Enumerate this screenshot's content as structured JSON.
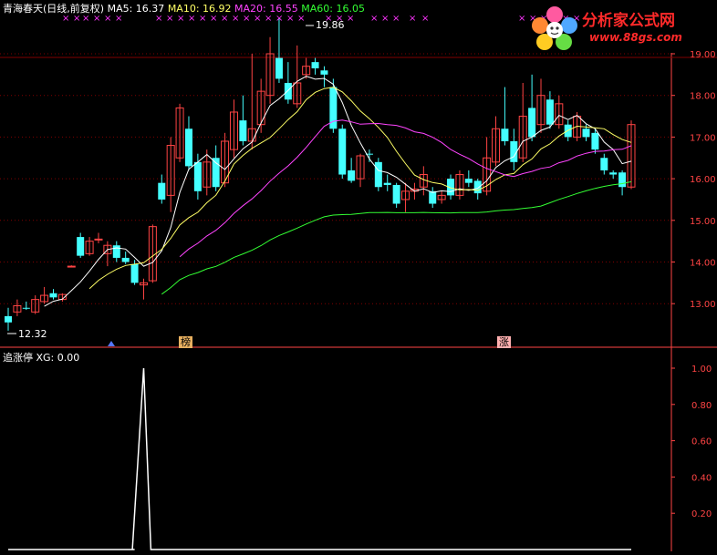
{
  "header": {
    "title": "青海春天(日线,前复权)",
    "ma": [
      {
        "label": "MA5: 16.37",
        "color": "#ffffff"
      },
      {
        "label": "MA10: 16.92",
        "color": "#ffff66"
      },
      {
        "label": "MA20: 16.55",
        "color": "#ff44ff"
      },
      {
        "label": "MA60: 16.05",
        "color": "#33ff33"
      }
    ]
  },
  "logo": {
    "title": "分析家公式网",
    "url": "www.88gs.com"
  },
  "price_annotations": {
    "high": "19.86",
    "low": "12.32"
  },
  "event_tags": [
    {
      "label": "榜",
      "color": "#e8b060"
    },
    {
      "label": "涨",
      "color": "#ffb0b0"
    }
  ],
  "indicator": {
    "label": "追涨停  XG: 0.00"
  },
  "colors": {
    "up": "#ff4444",
    "down": "#44ffff",
    "grid": "#800000",
    "axis": "#ff4444"
  },
  "chart_data": [
    {
      "type": "candlestick",
      "y_ticks": [
        "19.00",
        "18.00",
        "17.00",
        "16.00",
        "15.00",
        "14.00",
        "13.00"
      ],
      "ylim": [
        12.3,
        19.9
      ],
      "candles": [
        [
          12.7,
          12.55,
          12.9,
          12.35
        ],
        [
          12.8,
          12.95,
          13.1,
          12.7
        ],
        [
          12.9,
          12.88,
          13.05,
          12.85
        ],
        [
          12.8,
          13.1,
          13.2,
          12.75
        ],
        [
          13.05,
          13.2,
          13.4,
          13.0
        ],
        [
          13.25,
          13.15,
          13.35,
          13.1
        ],
        [
          13.1,
          13.22,
          13.25,
          13.05
        ],
        [
          13.9,
          13.9,
          13.92,
          13.88
        ],
        [
          14.6,
          14.15,
          14.7,
          14.1
        ],
        [
          14.2,
          14.5,
          14.6,
          14.15
        ],
        [
          14.55,
          14.55,
          14.7,
          14.45
        ],
        [
          14.2,
          14.4,
          14.5,
          13.9
        ],
        [
          14.4,
          14.1,
          14.5,
          14.0
        ],
        [
          14.1,
          14.0,
          14.25,
          13.95
        ],
        [
          13.95,
          13.5,
          14.05,
          13.45
        ],
        [
          13.45,
          13.5,
          13.6,
          13.1
        ],
        [
          13.55,
          14.85,
          14.9,
          13.5
        ],
        [
          15.9,
          15.5,
          16.1,
          15.4
        ],
        [
          15.6,
          16.8,
          17.0,
          15.2
        ],
        [
          16.5,
          17.7,
          17.8,
          16.4
        ],
        [
          17.2,
          16.3,
          17.5,
          16.2
        ],
        [
          16.4,
          15.7,
          16.6,
          15.5
        ],
        [
          15.8,
          16.4,
          16.7,
          15.6
        ],
        [
          16.5,
          15.8,
          16.8,
          15.7
        ],
        [
          15.9,
          16.9,
          17.1,
          15.8
        ],
        [
          16.7,
          17.6,
          17.9,
          16.5
        ],
        [
          17.4,
          16.9,
          18.0,
          16.8
        ],
        [
          16.9,
          17.2,
          19.0,
          16.7
        ],
        [
          17.3,
          18.1,
          18.4,
          17.1
        ],
        [
          18.0,
          19.0,
          19.4,
          17.8
        ],
        [
          18.9,
          18.4,
          19.86,
          18.3
        ],
        [
          18.3,
          17.9,
          18.8,
          17.8
        ],
        [
          17.8,
          18.3,
          19.2,
          17.7
        ],
        [
          18.5,
          18.7,
          18.9,
          18.4
        ],
        [
          18.8,
          18.65,
          18.9,
          18.5
        ],
        [
          18.6,
          18.5,
          18.7,
          18.2
        ],
        [
          18.2,
          17.2,
          18.4,
          17.1
        ],
        [
          17.2,
          16.1,
          17.3,
          16.0
        ],
        [
          16.2,
          15.95,
          16.5,
          15.9
        ],
        [
          16.0,
          16.55,
          16.6,
          15.8
        ],
        [
          16.6,
          16.58,
          16.7,
          16.4
        ],
        [
          16.4,
          15.8,
          16.5,
          15.7
        ],
        [
          15.9,
          15.85,
          16.1,
          15.7
        ],
        [
          15.85,
          15.4,
          15.9,
          15.3
        ],
        [
          15.5,
          15.7,
          15.9,
          15.2
        ],
        [
          15.7,
          15.75,
          15.9,
          15.5
        ],
        [
          15.8,
          16.1,
          16.3,
          15.6
        ],
        [
          15.7,
          15.4,
          15.8,
          15.3
        ],
        [
          15.5,
          15.6,
          15.7,
          15.4
        ],
        [
          16.0,
          15.6,
          16.1,
          15.5
        ],
        [
          15.6,
          16.1,
          16.2,
          15.5
        ],
        [
          16.0,
          15.9,
          16.2,
          15.8
        ],
        [
          15.95,
          15.65,
          16.0,
          15.5
        ],
        [
          15.7,
          16.5,
          17.0,
          15.6
        ],
        [
          16.4,
          17.2,
          17.5,
          16.3
        ],
        [
          17.2,
          16.9,
          18.2,
          16.8
        ],
        [
          16.9,
          16.4,
          17.2,
          16.2
        ],
        [
          16.5,
          17.5,
          18.3,
          16.4
        ],
        [
          17.7,
          17.0,
          18.5,
          16.9
        ],
        [
          17.3,
          18.0,
          18.4,
          17.1
        ],
        [
          17.9,
          17.3,
          18.1,
          17.2
        ],
        [
          17.3,
          17.8,
          18.0,
          17.2
        ],
        [
          17.3,
          17.0,
          17.4,
          16.9
        ],
        [
          17.0,
          17.5,
          17.6,
          16.9
        ],
        [
          17.2,
          17.0,
          17.3,
          16.9
        ],
        [
          17.1,
          16.7,
          17.2,
          16.6
        ],
        [
          16.5,
          16.2,
          16.6,
          16.1
        ],
        [
          16.15,
          16.1,
          16.2,
          16.0
        ],
        [
          16.15,
          15.8,
          16.2,
          15.6
        ],
        [
          15.8,
          17.3,
          17.4,
          15.75
        ]
      ]
    },
    {
      "type": "line",
      "name": "XG",
      "y_ticks": [
        "1.00",
        "0.80",
        "0.60",
        "0.40",
        "0.20"
      ],
      "ylim": [
        0,
        1.05
      ],
      "values": [
        0,
        0,
        0,
        0,
        0,
        0,
        0,
        0,
        0,
        0,
        0,
        0,
        0,
        0,
        0,
        0,
        0,
        0,
        0,
        0,
        0,
        0,
        0,
        0,
        0,
        0,
        0,
        0,
        0,
        0,
        0,
        0,
        0,
        0,
        0,
        0,
        0,
        0,
        0,
        0,
        0,
        0,
        0,
        0,
        0,
        0,
        0,
        0,
        0,
        0,
        0,
        0,
        0,
        0,
        0,
        0,
        0,
        0,
        0,
        0,
        0,
        0,
        0,
        0,
        0,
        0,
        0,
        0,
        0,
        0
      ],
      "spike_index": 15,
      "spike_value": 1.0
    }
  ]
}
